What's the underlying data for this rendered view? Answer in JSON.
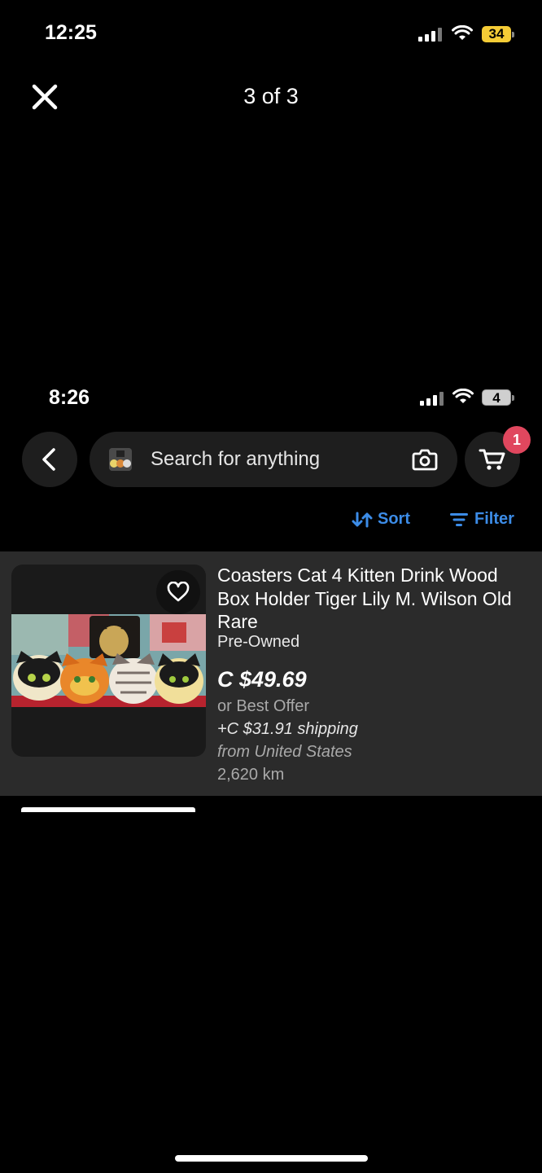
{
  "outer_status": {
    "time": "12:25",
    "battery": "34"
  },
  "viewer": {
    "title": "3 of 3",
    "close_icon": "close-icon"
  },
  "inner_status": {
    "time": "8:26",
    "battery": "4"
  },
  "header": {
    "search_placeholder": "Search for anything",
    "cart_count": "1",
    "icons": [
      "back-icon",
      "camera-icon",
      "cart-icon"
    ]
  },
  "toolbar": {
    "sort_label": "Sort",
    "filter_label": "Filter",
    "accent": "#3c8ce7"
  },
  "listing": {
    "title": "Coasters Cat 4  Kitten Drink Wood Box Holder Tiger Lily M. Wilson Old Rare",
    "condition": "Pre-Owned",
    "price": "C $49.69",
    "best_offer": "or Best Offer",
    "shipping": "+C $31.91 shipping",
    "origin": "from United States",
    "distance": "2,620 km"
  },
  "colors": {
    "badge": "#e0475e",
    "card_bg": "#2b2b2b",
    "battery_accent": "#f5cc36"
  }
}
